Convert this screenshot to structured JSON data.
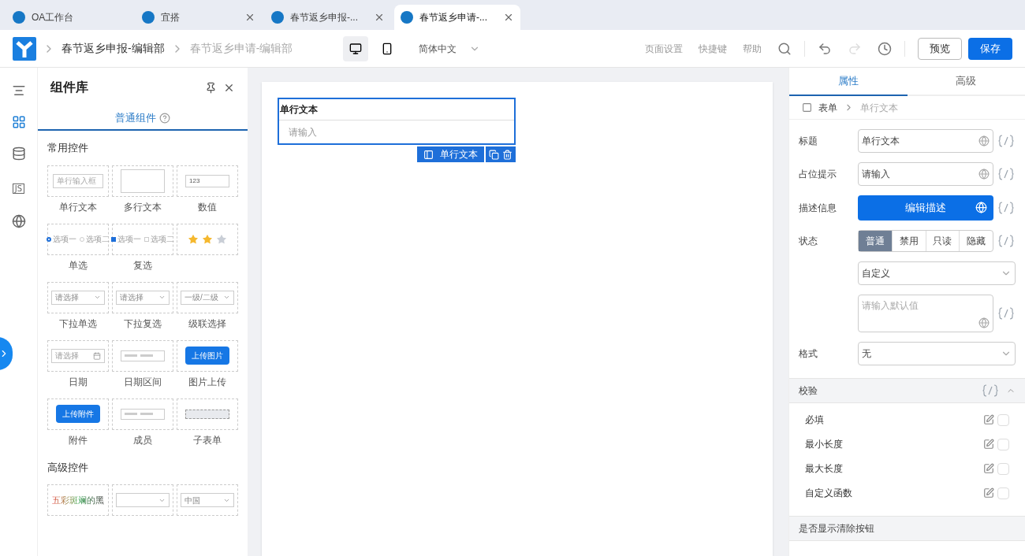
{
  "browser_tabs": [
    {
      "label": "OA工作台",
      "selected": false,
      "closable": false
    },
    {
      "label": "宜搭",
      "selected": false,
      "closable": true
    },
    {
      "label": "春节返乡申报-...",
      "selected": false,
      "closable": true
    },
    {
      "label": "春节返乡申请-...",
      "selected": true,
      "closable": true
    }
  ],
  "breadcrumb": [
    "春节返乡申报-编辑部",
    "春节返乡申请-编辑部"
  ],
  "devices": [
    {
      "kind": "desktop",
      "selected": true
    },
    {
      "kind": "mobile",
      "selected": false
    }
  ],
  "language": "简体中文",
  "toolbar_links": [
    "页面设置",
    "快捷键",
    "帮助"
  ],
  "preview_button": "预览",
  "save_button": "保存",
  "rail": [
    {
      "kind": "outline",
      "selected": false
    },
    {
      "kind": "components",
      "selected": true
    },
    {
      "kind": "data",
      "selected": false
    },
    {
      "kind": "js",
      "text": "JS",
      "selected": false
    },
    {
      "kind": "globe",
      "selected": false
    }
  ],
  "library": {
    "title": "组件库",
    "tab": "普通组件",
    "groups": [
      {
        "title": "常用控件",
        "items": [
          {
            "kind": "input",
            "preview": "单行输入框",
            "label": "单行文本"
          },
          {
            "kind": "textarea",
            "label": "多行文本"
          },
          {
            "kind": "number",
            "preview": "123",
            "label": "数值"
          },
          {
            "kind": "radio",
            "preview": "选项一",
            "preview2": "选项二",
            "label": "单选"
          },
          {
            "kind": "checkbox",
            "preview": "选项一",
            "preview2": "选项二",
            "label": "复选"
          },
          {
            "kind": "rating",
            "stars": 2
          },
          {
            "kind": "select",
            "preview": "请选择",
            "label": "下拉单选"
          },
          {
            "kind": "select",
            "preview": "请选择",
            "label": "下拉复选"
          },
          {
            "kind": "select",
            "preview": "一级/二级",
            "label": "级联选择"
          },
          {
            "kind": "date",
            "preview": "请选择",
            "label": "日期"
          },
          {
            "kind": "daterange",
            "label": "日期区间"
          },
          {
            "kind": "upload",
            "preview": "上传图片",
            "label": "图片上传"
          },
          {
            "kind": "upload",
            "preview": "上传附件",
            "label": "附件"
          },
          {
            "kind": "member",
            "label": "成员"
          },
          {
            "kind": "subform",
            "label": "子表单"
          }
        ]
      },
      {
        "title": "高级控件",
        "items": [
          {
            "kind": "colortext",
            "preview": "五彩斑斓的黑"
          },
          {
            "kind": "select"
          },
          {
            "kind": "select",
            "preview": "中国"
          }
        ]
      }
    ]
  },
  "canvas": {
    "field": {
      "label": "单行文本",
      "placeholder": "请输入",
      "selected": true,
      "tag": "单行文本"
    }
  },
  "props": {
    "tabs": [
      {
        "label": "属性",
        "selected": true
      },
      {
        "label": "高级",
        "selected": false
      }
    ],
    "crumbs": [
      "表单",
      "单行文本"
    ],
    "rows": [
      {
        "kind": "input",
        "label": "标题",
        "value": "单行文本"
      },
      {
        "kind": "input",
        "label": "占位提示",
        "value": "请输入"
      },
      {
        "kind": "button",
        "label": "描述信息",
        "value": "编辑描述"
      },
      {
        "kind": "segmented",
        "label": "状态",
        "options": [
          {
            "label": "普通",
            "selected": true
          },
          {
            "label": "禁用",
            "selected": false
          },
          {
            "label": "只读",
            "selected": false
          },
          {
            "label": "隐藏",
            "selected": false
          }
        ]
      },
      {
        "kind": "select",
        "value": "自定义"
      },
      {
        "kind": "textarea",
        "placeholder": "请输入默认值"
      },
      {
        "kind": "select",
        "label": "格式",
        "value": "无"
      }
    ],
    "validation": {
      "title": "校验",
      "expanded": true,
      "rules": [
        {
          "label": "必填",
          "checked": false
        },
        {
          "label": "最小长度",
          "checked": false
        },
        {
          "label": "最大长度",
          "checked": false
        },
        {
          "label": "自定义函数",
          "checked": false
        }
      ]
    },
    "clear_section": "是否显示清除按钮"
  }
}
